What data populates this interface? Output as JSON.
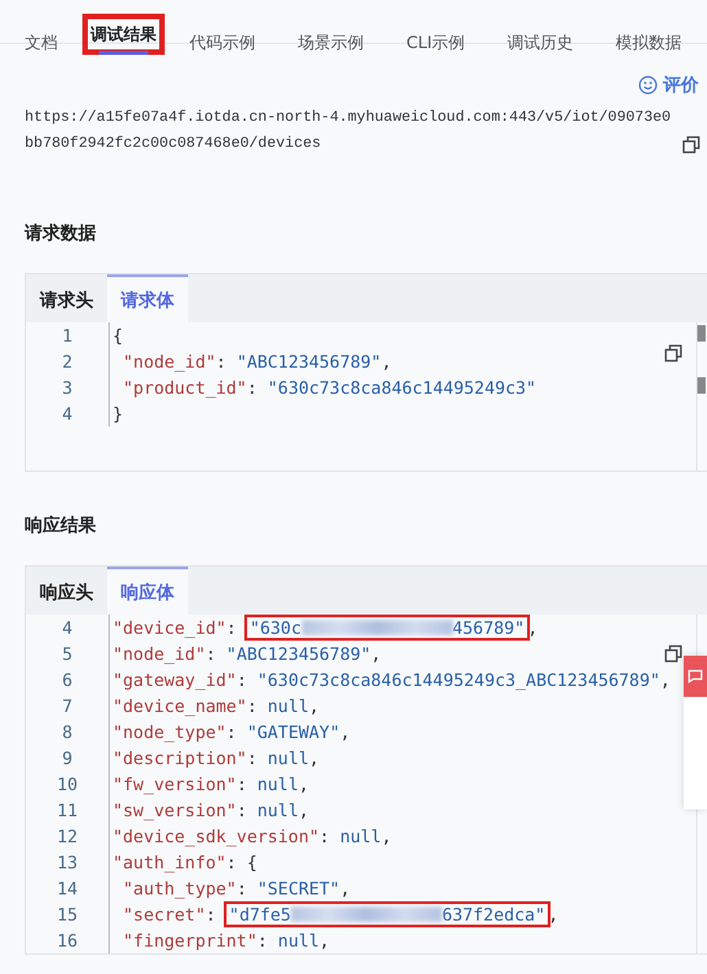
{
  "tabs": [
    {
      "label": "文档",
      "selected": false,
      "annotated": false
    },
    {
      "label": "调试结果",
      "selected": true,
      "annotated": true
    },
    {
      "label": "代码示例",
      "selected": false,
      "annotated": false
    },
    {
      "label": "场景示例",
      "selected": false,
      "annotated": false
    },
    {
      "label": "CLI示例",
      "selected": false,
      "annotated": false
    },
    {
      "label": "调试历史",
      "selected": false,
      "annotated": false
    },
    {
      "label": "模拟数据",
      "selected": false,
      "annotated": false
    }
  ],
  "url_section": {
    "rate_label": "评价",
    "url": "https://a15fe07a4f.iotda.cn-north-4.myhuaweicloud.com:443/v5/iot/09073e0bb780f2942fc2c00c087468e0/devices"
  },
  "request": {
    "heading": "请求数据",
    "tabs": [
      {
        "label": "请求头",
        "selected": false
      },
      {
        "label": "请求体",
        "selected": true
      }
    ],
    "lines": [
      {
        "number": "1",
        "annotated": false,
        "tokens": [
          {
            "kind": "punct",
            "text": "{"
          }
        ]
      },
      {
        "number": "2",
        "annotated": false,
        "tokens": [
          {
            "kind": "key",
            "text": " \"node_id\""
          },
          {
            "kind": "punct",
            "text": ": "
          },
          {
            "kind": "string",
            "text": "\"ABC123456789\""
          },
          {
            "kind": "punct",
            "text": ","
          }
        ]
      },
      {
        "number": "3",
        "annotated": false,
        "tokens": [
          {
            "kind": "key",
            "text": " \"product_id\""
          },
          {
            "kind": "punct",
            "text": ": "
          },
          {
            "kind": "string",
            "text": "\"630c73c8ca846c14495249c3\""
          }
        ]
      },
      {
        "number": "4",
        "annotated": false,
        "tokens": [
          {
            "kind": "punct",
            "text": "}"
          }
        ]
      }
    ]
  },
  "response": {
    "heading": "响应结果",
    "tabs": [
      {
        "label": "响应头",
        "selected": false
      },
      {
        "label": "响应体",
        "selected": true
      }
    ],
    "lines": [
      {
        "number": "4",
        "annotated": true,
        "tokens": [
          {
            "kind": "key",
            "text": "\"device_id\""
          },
          {
            "kind": "punct",
            "text": ": "
          },
          {
            "kind": "string",
            "text": "\"630c"
          },
          {
            "kind": "blur"
          },
          {
            "kind": "string",
            "text": "456789\""
          },
          {
            "kind": "punct",
            "text": ","
          }
        ]
      },
      {
        "number": "5",
        "annotated": false,
        "tokens": [
          {
            "kind": "key",
            "text": "\"node_id\""
          },
          {
            "kind": "punct",
            "text": ": "
          },
          {
            "kind": "string",
            "text": "\"ABC123456789\""
          },
          {
            "kind": "punct",
            "text": ","
          }
        ]
      },
      {
        "number": "6",
        "annotated": false,
        "tokens": [
          {
            "kind": "key",
            "text": "\"gateway_id\""
          },
          {
            "kind": "punct",
            "text": ": "
          },
          {
            "kind": "string",
            "text": "\"630c73c8ca846c14495249c3_ABC123456789\""
          },
          {
            "kind": "punct",
            "text": ","
          }
        ]
      },
      {
        "number": "7",
        "annotated": false,
        "tokens": [
          {
            "kind": "key",
            "text": "\"device_name\""
          },
          {
            "kind": "punct",
            "text": ": "
          },
          {
            "kind": "literal",
            "text": "null"
          },
          {
            "kind": "punct",
            "text": ","
          }
        ]
      },
      {
        "number": "8",
        "annotated": false,
        "tokens": [
          {
            "kind": "key",
            "text": "\"node_type\""
          },
          {
            "kind": "punct",
            "text": ": "
          },
          {
            "kind": "string",
            "text": "\"GATEWAY\""
          },
          {
            "kind": "punct",
            "text": ","
          }
        ]
      },
      {
        "number": "9",
        "annotated": false,
        "tokens": [
          {
            "kind": "key",
            "text": "\"description\""
          },
          {
            "kind": "punct",
            "text": ": "
          },
          {
            "kind": "literal",
            "text": "null"
          },
          {
            "kind": "punct",
            "text": ","
          }
        ]
      },
      {
        "number": "10",
        "annotated": false,
        "tokens": [
          {
            "kind": "key",
            "text": "\"fw_version\""
          },
          {
            "kind": "punct",
            "text": ": "
          },
          {
            "kind": "literal",
            "text": "null"
          },
          {
            "kind": "punct",
            "text": ","
          }
        ]
      },
      {
        "number": "11",
        "annotated": false,
        "tokens": [
          {
            "kind": "key",
            "text": "\"sw_version\""
          },
          {
            "kind": "punct",
            "text": ": "
          },
          {
            "kind": "literal",
            "text": "null"
          },
          {
            "kind": "punct",
            "text": ","
          }
        ]
      },
      {
        "number": "12",
        "annotated": false,
        "tokens": [
          {
            "kind": "key",
            "text": "\"device_sdk_version\""
          },
          {
            "kind": "punct",
            "text": ": "
          },
          {
            "kind": "literal",
            "text": "null"
          },
          {
            "kind": "punct",
            "text": ","
          }
        ]
      },
      {
        "number": "13",
        "annotated": false,
        "tokens": [
          {
            "kind": "key",
            "text": "\"auth_info\""
          },
          {
            "kind": "punct",
            "text": ": {"
          }
        ]
      },
      {
        "number": "14",
        "annotated": false,
        "tokens": [
          {
            "kind": "key",
            "text": " \"auth_type\""
          },
          {
            "kind": "punct",
            "text": ": "
          },
          {
            "kind": "string",
            "text": "\"SECRET\""
          },
          {
            "kind": "punct",
            "text": ","
          }
        ]
      },
      {
        "number": "15",
        "annotated": true,
        "tokens": [
          {
            "kind": "key",
            "text": " \"secret\""
          },
          {
            "kind": "punct",
            "text": ": "
          },
          {
            "kind": "string",
            "text": "\"d7fe5"
          },
          {
            "kind": "blur"
          },
          {
            "kind": "string",
            "text": "637f2edca\""
          },
          {
            "kind": "punct",
            "text": ","
          }
        ]
      },
      {
        "number": "16",
        "annotated": false,
        "tokens": [
          {
            "kind": "key",
            "text": " \"fingerprint\""
          },
          {
            "kind": "punct",
            "text": ": "
          },
          {
            "kind": "literal",
            "text": "null"
          },
          {
            "kind": "punct",
            "text": ","
          }
        ]
      }
    ]
  }
}
